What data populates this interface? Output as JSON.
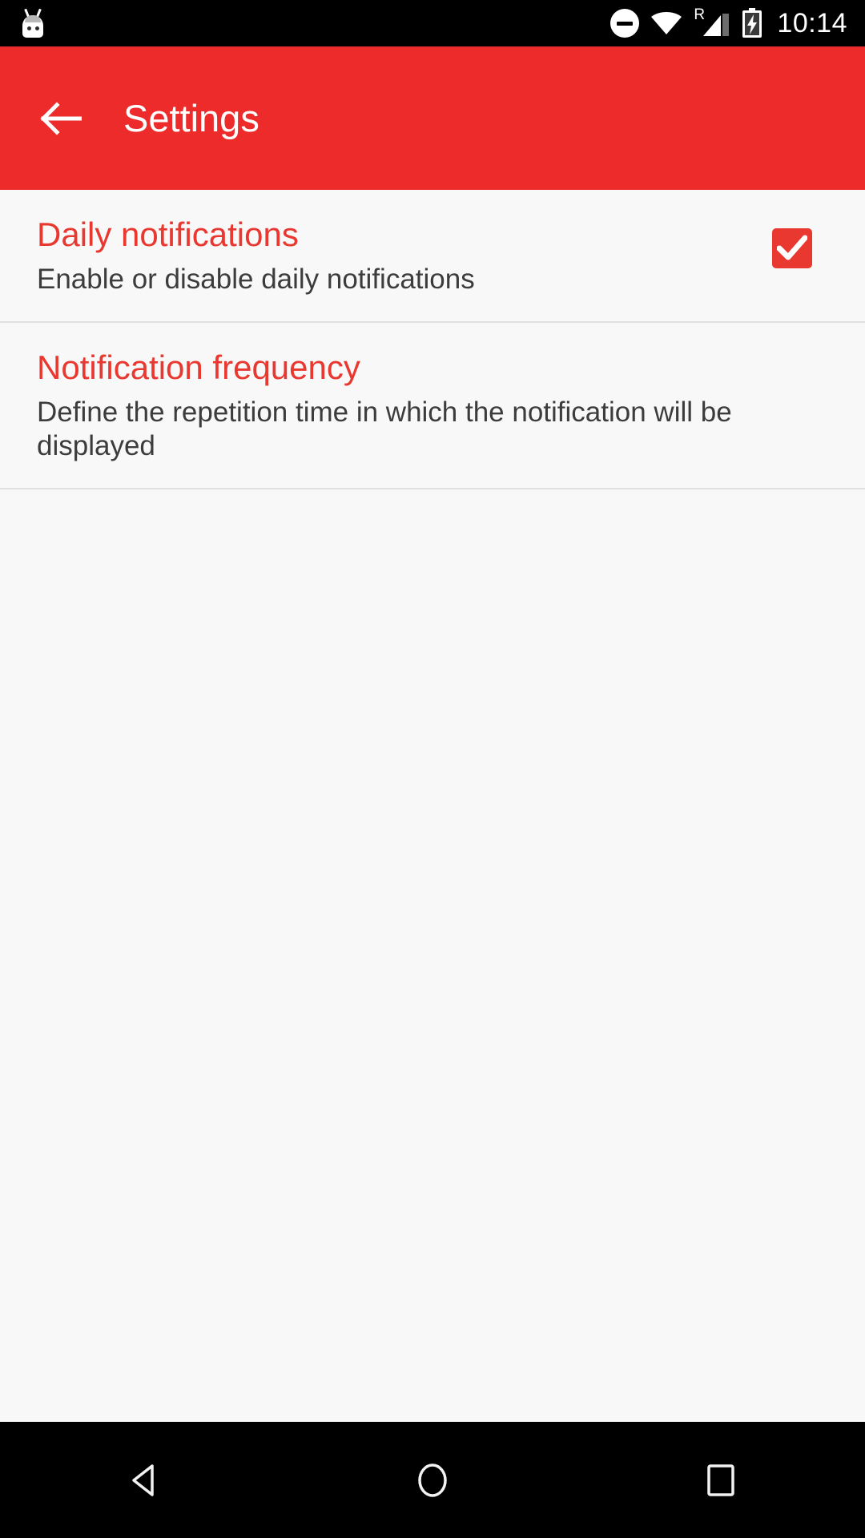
{
  "status_bar": {
    "app_icon": "android-mascot-icon",
    "icons": [
      "do-not-disturb-icon",
      "wifi-icon",
      "roaming-signal-icon",
      "battery-charging-icon"
    ],
    "roaming_label": "R",
    "time": "10:14"
  },
  "app_bar": {
    "back_label": "back-arrow-icon",
    "title": "Settings",
    "background_color": "#ee2b2b",
    "text_color": "#ffffff"
  },
  "preferences": [
    {
      "title": "Daily notifications",
      "summary": "Enable or disable daily notifications",
      "widget": "checkbox",
      "checked": true
    },
    {
      "title": "Notification frequency",
      "summary": "Define the repetition time in which the notification will be displayed",
      "widget": "none",
      "checked": false
    }
  ],
  "colors": {
    "accent": "#e8382f",
    "background": "#f8f8f8",
    "summary_text": "#3c3c3c",
    "divider": "#e0e0e0"
  },
  "nav_bar": {
    "buttons": [
      "back-nav-icon",
      "home-nav-icon",
      "recents-nav-icon"
    ]
  }
}
